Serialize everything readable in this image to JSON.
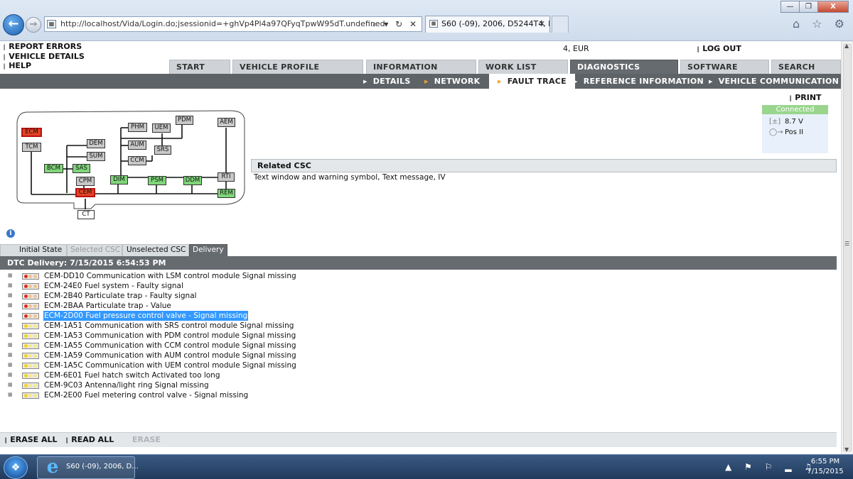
{
  "browser": {
    "address": "http://localhost/Vida/Login.do;jsessionid=+ghVp4Pl4a97QFyqTpwW95dT.undefined",
    "address_tools": "⌕ ▾ ↻ ✕",
    "tab_title": "S60 (-09), 2006, D5244T4, M...",
    "tab_close": "✕",
    "window_buttons": [
      "—",
      "❐",
      "X"
    ],
    "toolbar_icons": "⌂ ☆ ⚙"
  },
  "header": {
    "links": [
      "REPORT ERRORS",
      "VEHICLE DETAILS",
      "HELP"
    ],
    "currency": "4, EUR",
    "logout": "LOG OUT"
  },
  "main_tabs": [
    "START",
    "VEHICLE PROFILE",
    "INFORMATION",
    "WORK LIST",
    "DIAGNOSTICS",
    "SOFTWARE",
    "SEARCH"
  ],
  "active_main_tab": "DIAGNOSTICS",
  "sub_tabs": [
    "DETAILS",
    "NETWORK",
    "FAULT TRACE",
    "REFERENCE INFORMATION",
    "VEHICLE COMMUNICATION"
  ],
  "active_sub_tab": "FAULT TRACE",
  "print_label": "PRINT",
  "status": {
    "connection": "Connected",
    "voltage": "8.7 V",
    "key_position": "Pos II",
    "battery_icon": "battery-icon",
    "key_icon": "key-icon",
    "connection_color": "#9ad58e"
  },
  "network": {
    "nodes": [
      "ECM",
      "TCM",
      "DEM",
      "SUM",
      "BCM",
      "SAS",
      "CPM",
      "CEM",
      "CT",
      "PHM",
      "AUM",
      "CCM",
      "UEM",
      "SRS",
      "PDM",
      "DIM",
      "PSM",
      "DDM",
      "AEM",
      "RTI",
      "REM"
    ],
    "fault_color": "#e04426",
    "ok_color": "#7fd67a",
    "inactive_color": "#c8c8c8"
  },
  "related_csc": {
    "title": "Related CSC",
    "text": "Text window and warning symbol, Text message, IV"
  },
  "dtc_tabs": [
    "Initial State",
    "Selected CSC",
    "Unselected CSC",
    "Delivery"
  ],
  "active_dtc_tab": "Delivery",
  "dtc_header": "DTC Delivery: 7/15/2015 6:54:53 PM",
  "dtcs": [
    {
      "text": "CEM-DD10 Communication with LSM control module Signal missing",
      "severity": "red"
    },
    {
      "text": "ECM-24E0 Fuel system - Faulty signal",
      "severity": "red"
    },
    {
      "text": "ECM-2B40 Particulate trap - Faulty signal",
      "severity": "red"
    },
    {
      "text": "ECM-2BAA Particulate trap - Value",
      "severity": "red"
    },
    {
      "text": "ECM-2D00 Fuel pressure control valve - Signal missing",
      "severity": "red",
      "selected": true
    },
    {
      "text": "CEM-1A51 Communication with SRS control module Signal missing",
      "severity": "yellow"
    },
    {
      "text": "CEM-1A53 Communication with PDM control module Signal missing",
      "severity": "yellow"
    },
    {
      "text": "CEM-1A55 Communication with CCM control module Signal missing",
      "severity": "yellow"
    },
    {
      "text": "CEM-1A59 Communication with AUM control module Signal missing",
      "severity": "yellow"
    },
    {
      "text": "CEM-1A5C Communication with UEM control module Signal missing",
      "severity": "yellow"
    },
    {
      "text": "CEM-6E01 Fuel hatch switch Activated too long",
      "severity": "yellow"
    },
    {
      "text": "CEM-9C03 Antenna/light ring Signal missing",
      "severity": "yellow"
    },
    {
      "text": "ECM-2E00 Fuel metering control valve - Signal missing",
      "severity": "yellow"
    }
  ],
  "bottom_actions": [
    "ERASE ALL",
    "READ ALL",
    "ERASE"
  ],
  "taskbar": {
    "item_label": "S60 (-09), 2006, D...",
    "time": "6:55 PM",
    "date": "7/15/2015",
    "tray_icons": "▲ ⚑ ⚐ ▂ ♫"
  }
}
